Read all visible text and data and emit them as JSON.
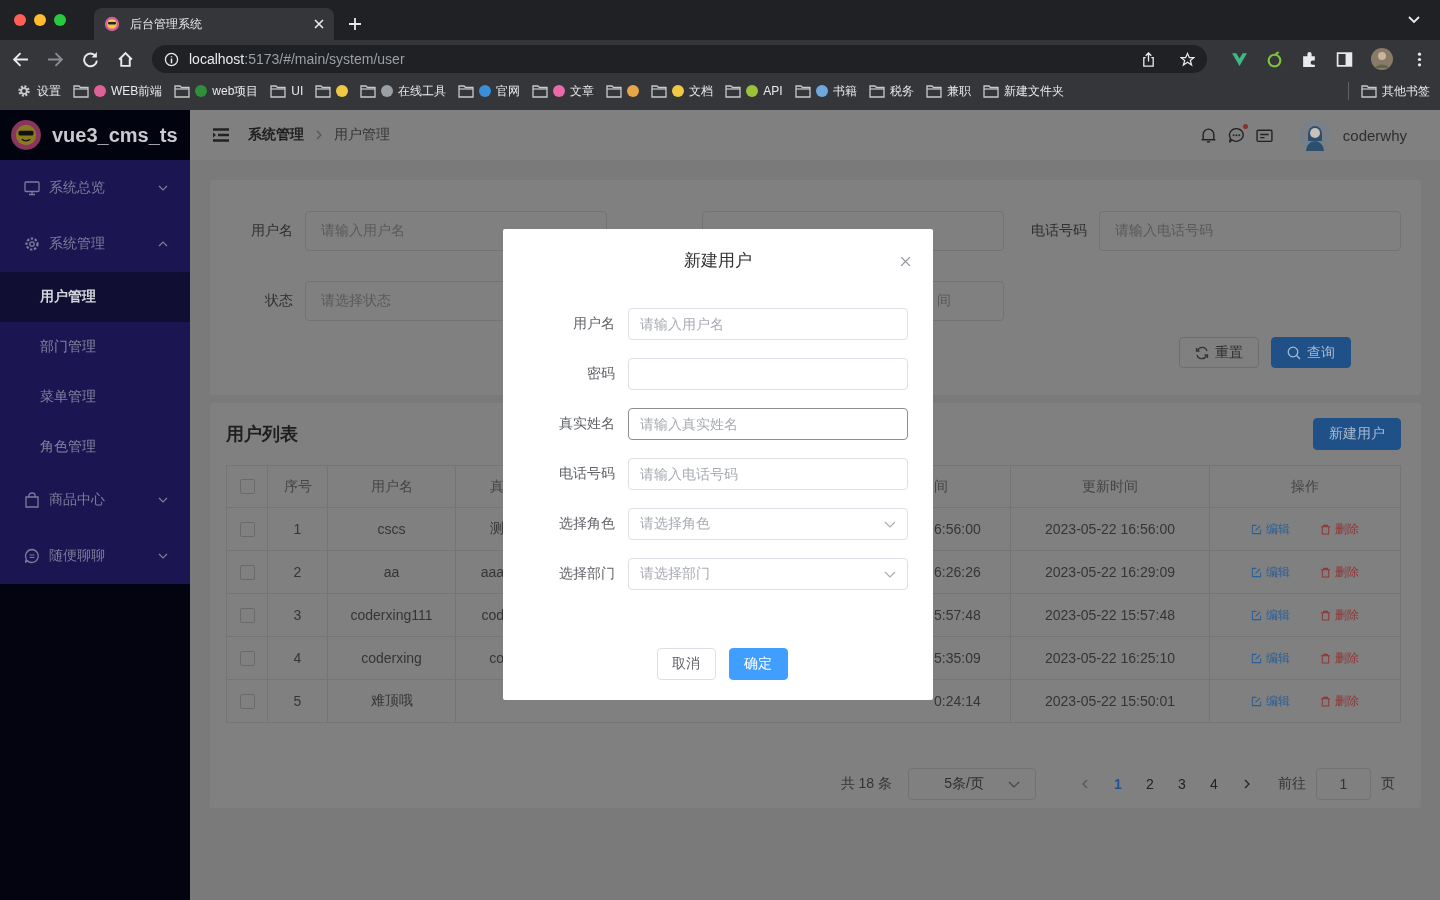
{
  "browser": {
    "tab_title": "后台管理系统",
    "url_host": "localhost",
    "url_path": ":5173/#/main/system/user",
    "bookmarks": [
      {
        "label": "设置",
        "kind": "settings"
      },
      {
        "label": "WEB前端",
        "kind": "folder",
        "color": "#e0609a"
      },
      {
        "label": "web项目",
        "kind": "folder",
        "color": "#2f8f3a"
      },
      {
        "label": "UI",
        "kind": "folder"
      },
      {
        "kind": "folder",
        "color": "#f2c744"
      },
      {
        "label": "在线工具",
        "kind": "folder",
        "color": "#9aa0a6"
      },
      {
        "label": "官网",
        "kind": "folder",
        "color": "#3a8fd8"
      },
      {
        "label": "文章",
        "kind": "folder",
        "color": "#e86aa8"
      },
      {
        "kind": "folder",
        "color": "#e8a64a"
      },
      {
        "label": "文档",
        "kind": "folder",
        "color": "#f2c744"
      },
      {
        "label": "API",
        "kind": "folder",
        "color": "#9cc23a"
      },
      {
        "label": "书籍",
        "kind": "folder",
        "color": "#6fa8dc"
      },
      {
        "label": "税务",
        "kind": "folder"
      },
      {
        "label": "兼职",
        "kind": "folder"
      },
      {
        "label": "新建文件夹",
        "kind": "folder"
      }
    ],
    "other_bookmarks": "其他书签"
  },
  "sidebar": {
    "logo": "vue3_cms_ts",
    "menu": [
      {
        "label": "系统总览",
        "expanded": false
      },
      {
        "label": "系统管理",
        "expanded": true,
        "children": [
          {
            "label": "用户管理",
            "selected": true
          },
          {
            "label": "部门管理",
            "selected": false
          },
          {
            "label": "菜单管理",
            "selected": false
          },
          {
            "label": "角色管理",
            "selected": false
          }
        ]
      },
      {
        "label": "商品中心",
        "expanded": false
      },
      {
        "label": "随便聊聊",
        "expanded": false
      }
    ]
  },
  "header": {
    "breadcrumb": [
      "系统管理",
      "用户管理"
    ],
    "unread_messages": true,
    "username": "coderwhy"
  },
  "search_form": {
    "rows": [
      [
        {
          "label": "用户名",
          "placeholder": "请输入用户名"
        },
        {},
        {
          "label": "电话号码",
          "placeholder": "请输入电话号码"
        }
      ],
      [
        {
          "label": "状态",
          "placeholder": "请选择状态"
        },
        {
          "placeholder": "间",
          "cut": true
        }
      ]
    ],
    "buttons": [
      "重置",
      "查询"
    ]
  },
  "user_list": {
    "title": "用户列表",
    "create_button": "新建用户",
    "columns": [
      "序号",
      "用户名",
      "真",
      "间",
      "更新时间",
      "操作"
    ],
    "header_checked": false,
    "rows": [
      {
        "checked": false,
        "cells": [
          "1",
          "cscs",
          "测",
          "6:56:00",
          "2023-05-22 16:56:00"
        ],
        "actions": [
          "编辑",
          "删除"
        ]
      },
      {
        "checked": false,
        "cells": [
          "2",
          "aa",
          "aaa",
          "6:26:26",
          "2023-05-22 16:29:09"
        ],
        "actions": [
          "编辑",
          "删除"
        ]
      },
      {
        "checked": false,
        "cells": [
          "3",
          "coderxing111",
          "cod",
          "5:57:48",
          "2023-05-22 15:57:48"
        ],
        "actions": [
          "编辑",
          "删除"
        ]
      },
      {
        "checked": false,
        "cells": [
          "4",
          "coderxing",
          "co",
          "5:35:09",
          "2023-05-22 16:25:10"
        ],
        "actions": [
          "编辑",
          "删除"
        ]
      },
      {
        "checked": false,
        "cells": [
          "5",
          "难顶哦",
          "",
          "0:24:14",
          "2023-05-22 15:50:01"
        ],
        "actions": [
          "编辑",
          "删除"
        ]
      }
    ]
  },
  "pagination": {
    "total": "共 18 条",
    "page_size": "5条/页",
    "pages": [
      {
        "label": "1",
        "selected": true
      },
      {
        "label": "2",
        "selected": false
      },
      {
        "label": "3",
        "selected": false
      },
      {
        "label": "4",
        "selected": false
      }
    ],
    "goto_label": "前往",
    "goto_value": "1",
    "goto_suffix": "页"
  },
  "dialog": {
    "title": "新建用户",
    "fields": [
      {
        "label": "用户名",
        "kind": "input",
        "placeholder": "请输入用户名",
        "focused": false
      },
      {
        "label": "密码",
        "kind": "input",
        "focused": false
      },
      {
        "label": "真实姓名",
        "kind": "input",
        "placeholder": "请输入真实姓名",
        "focused": true
      },
      {
        "label": "电话号码",
        "kind": "input",
        "placeholder": "请输入电话号码",
        "focused": false
      },
      {
        "label": "选择角色",
        "kind": "select",
        "placeholder": "请选择角色",
        "focused": false
      },
      {
        "label": "选择部门",
        "kind": "select",
        "placeholder": "请选择部门",
        "focused": false
      }
    ],
    "buttons": [
      "取消",
      "确定"
    ]
  }
}
